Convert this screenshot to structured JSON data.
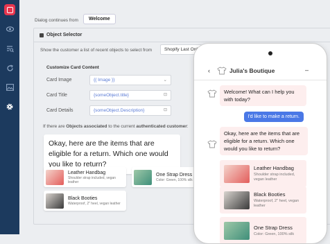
{
  "sidebar": {
    "icons": [
      "app-logo-icon",
      "eye-icon",
      "list-search-icon",
      "refresh-icon",
      "image-icon",
      "gear-icon"
    ]
  },
  "dialog": {
    "continues_label": "Dialog continues from",
    "continues_value": "Welcome"
  },
  "object_selector": {
    "title": "Object Selector",
    "instruction": "Show the customer a list of recent objects to select from",
    "source_value": "Shopify Last Ord"
  },
  "customize": {
    "heading": "Customize Card Content",
    "fields": [
      {
        "label": "Card Image",
        "value": "{{ Image }}"
      },
      {
        "label": "Card Title",
        "value": "{someObject.title}"
      },
      {
        "label": "Card Details",
        "value": "{someObject.Description}"
      }
    ]
  },
  "condition": {
    "prefix": "If there are ",
    "objects": "Objects associated",
    "middle": " to the current ",
    "auth": "authenticated customer",
    "suffix": ":"
  },
  "preview": {
    "message": "Okay, here are the items that are eligible for a return. Which one would you like to return?",
    "cards": [
      {
        "title": "Leather Handbag",
        "desc": "Shoulder strap included, vegan leather"
      },
      {
        "title": "One Strap Dress",
        "desc": "Color: Green, 100% silk"
      },
      {
        "title": "Black Booties",
        "desc": "Waterproof, 2\" heel, vegan leather"
      }
    ]
  },
  "phone": {
    "shop_name": "Julia's Boutique",
    "messages": {
      "welcome": "Welcome! What can I help you with today?",
      "user": "I'd like to make a return.",
      "eligible": "Okay, here are the items that are eligible for a return. Which one would you like to return?"
    },
    "products": [
      {
        "title": "Leather Handbag",
        "desc": "Shoulder strap included, vegan leather"
      },
      {
        "title": "Black Booties",
        "desc": "Waterproof, 2\" heel, vegan leather"
      },
      {
        "title": "One Strap Dress",
        "desc": "Color: Green, 100% silk"
      }
    ]
  },
  "colors": {
    "sidebar": "#1c3a5e",
    "accent": "#e6354e",
    "link": "#5a7bd5",
    "user_bubble": "#4a78e6",
    "bot_bubble": "#fdeeee"
  }
}
